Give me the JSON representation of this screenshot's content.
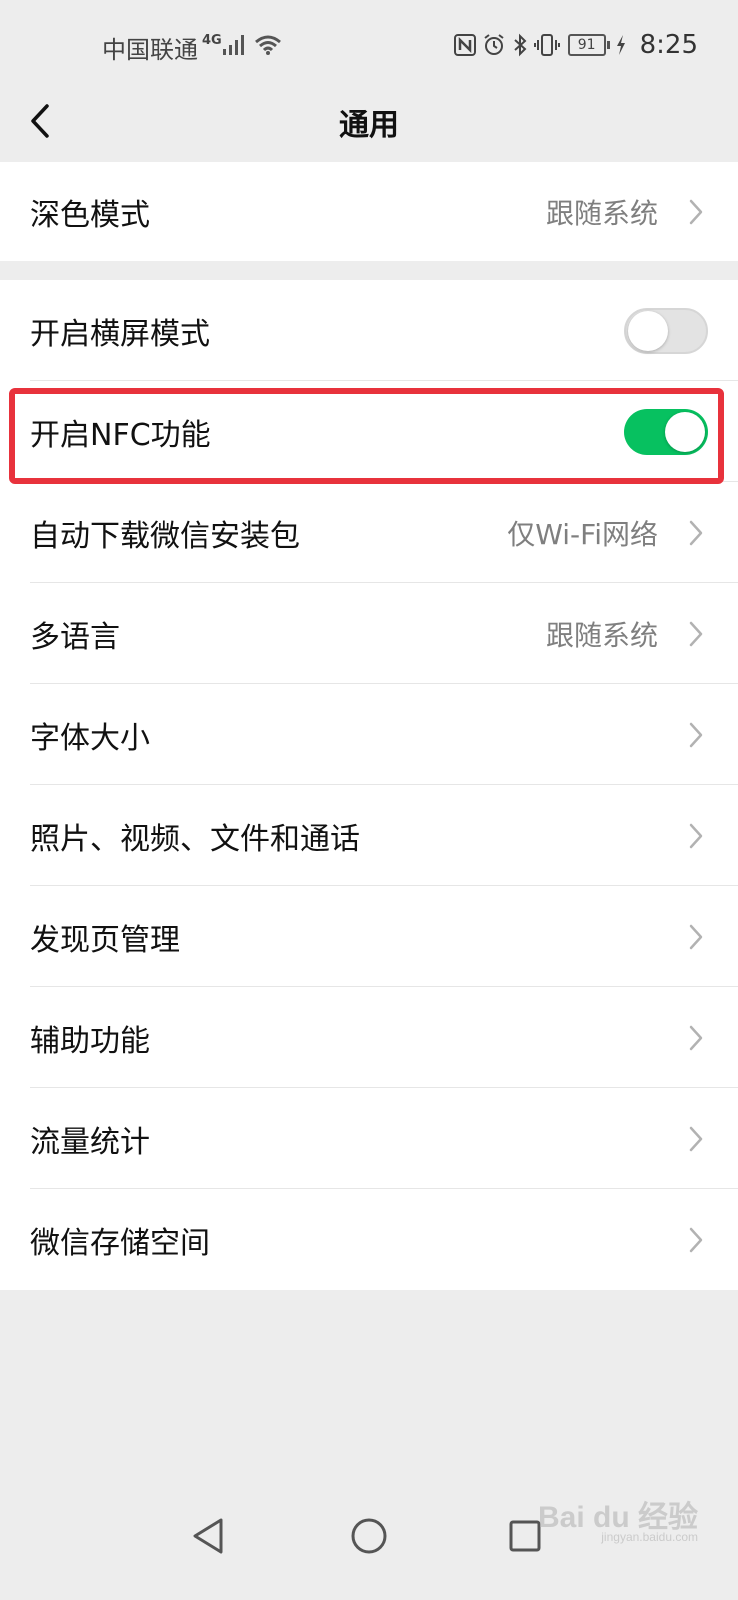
{
  "status_bar": {
    "carrier": "中国联通",
    "network_type": "4G",
    "battery_level": "91",
    "time": "8:25",
    "icons": [
      "signal-icon",
      "wifi-icon",
      "nfc-icon",
      "alarm-icon",
      "bluetooth-icon",
      "vibrate-icon",
      "battery-icon",
      "charging-icon"
    ]
  },
  "nav": {
    "title": "通用",
    "back_icon": "chevron-left-icon"
  },
  "group1": {
    "items": [
      {
        "label": "深色模式",
        "value": "跟随系统"
      }
    ]
  },
  "group2": {
    "items": [
      {
        "label": "开启横屏模式",
        "toggle": false
      },
      {
        "label": "开启NFC功能",
        "toggle": true
      },
      {
        "label": "自动下载微信安装包",
        "value": "仅Wi-Fi网络"
      },
      {
        "label": "多语言",
        "value": "跟随系统"
      },
      {
        "label": "字体大小",
        "value": ""
      },
      {
        "label": "照片、视频、文件和通话",
        "value": ""
      },
      {
        "label": "发现页管理",
        "value": ""
      },
      {
        "label": "辅助功能",
        "value": ""
      },
      {
        "label": "流量统计",
        "value": ""
      },
      {
        "label": "微信存储空间",
        "value": ""
      }
    ]
  },
  "colors": {
    "accent": "#07c160",
    "highlight": "#e8323c",
    "background": "#ededed"
  },
  "watermark": {
    "text": "Bai du 经验",
    "sub": "jingyan.baidu.com"
  }
}
